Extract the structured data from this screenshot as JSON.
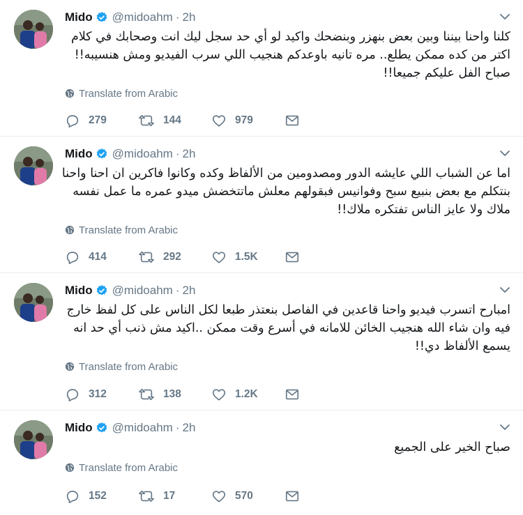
{
  "tweets": [
    {
      "name": "Mido",
      "handle": "@midoahm",
      "dot": "·",
      "time": "2h",
      "lines": [
        "كلنا واحنا بيننا وبين بعض بنهزر وبنضحك واكيد لو أي حد سجل ليك انت وصحابك في كلام",
        "اكتر من كده ممكن يطلع.. مره تانيه باوعدكم هنجيب اللي سرب الفيديو ومش هنسيبه!!",
        "صباح الفل عليكم جميعا!!"
      ],
      "translate": "Translate from Arabic",
      "replies": "279",
      "retweets": "144",
      "likes": "979"
    },
    {
      "name": "Mido",
      "handle": "@midoahm",
      "dot": "·",
      "time": "2h",
      "lines": [
        "اما عن الشباب اللي عايشه الدور ومصدومين من الألفاظ وكده وكانوا فاكرين ان احنا واحنا",
        "بنتكلم مع بعض بنبيع سبح وفوانيس فبقولهم معلش ماتتخضش ميدو عمره ما عمل نفسه",
        "ملاك ولا عايز الناس تفتكره ملاك!!"
      ],
      "translate": "Translate from Arabic",
      "replies": "414",
      "retweets": "292",
      "likes": "1.5K"
    },
    {
      "name": "Mido",
      "handle": "@midoahm",
      "dot": "·",
      "time": "2h",
      "lines": [
        "امبارح اتسرب فيديو واحنا قاعدين في الفاصل بنعتذر طبعا لكل الناس على كل لفظ خارج",
        "فيه وان شاء الله هنجيب الخائن للامانه في أسرع وقت ممكن ..اكيد مش ذنب أي حد انه",
        "يسمع الألفاظ دي!!"
      ],
      "translate": "Translate from Arabic",
      "replies": "312",
      "retweets": "138",
      "likes": "1.2K"
    },
    {
      "name": "Mido",
      "handle": "@midoahm",
      "dot": "·",
      "time": "2h",
      "lines": [
        "صباح الخير على الجميع"
      ],
      "translate": "Translate from Arabic",
      "replies": "152",
      "retweets": "17",
      "likes": "570"
    }
  ],
  "icons": {
    "verified": "verified-badge-icon",
    "caret": "chevron-down-icon",
    "globe": "globe-icon",
    "reply": "reply-icon",
    "retweet": "retweet-icon",
    "like": "heart-icon",
    "dm": "envelope-icon"
  },
  "colors": {
    "verified": "#1da1f2",
    "secondary_text": "#657786",
    "primary_text": "#14171a",
    "divider": "#e6ecf0"
  }
}
